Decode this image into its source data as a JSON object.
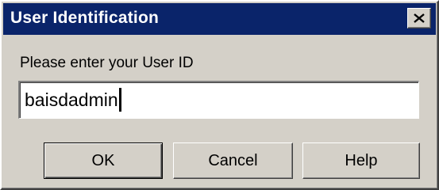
{
  "window": {
    "title": "User Identification",
    "close_icon": "close-icon"
  },
  "form": {
    "prompt": "Please enter your User ID",
    "user_id_value": "baisdadmin"
  },
  "buttons": {
    "ok_label": "OK",
    "cancel_label": "Cancel",
    "help_label": "Help"
  },
  "colors": {
    "titlebar": "#0a246a",
    "face": "#d4d0c8"
  }
}
